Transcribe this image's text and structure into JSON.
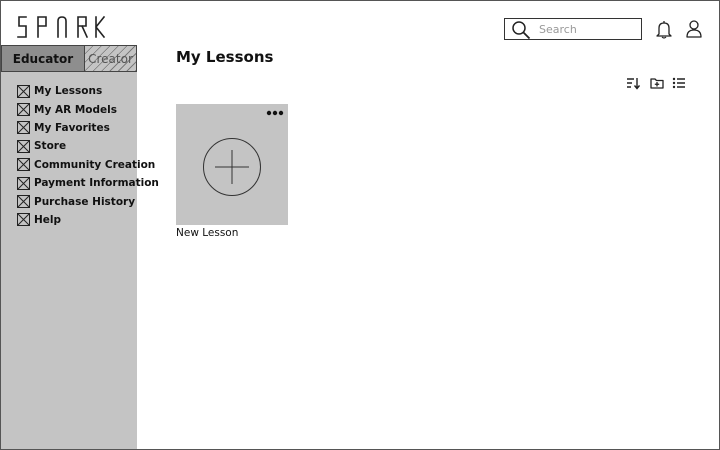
{
  "app": {
    "logo_text": "SPARK"
  },
  "header": {
    "search": {
      "placeholder": "Search",
      "value": ""
    }
  },
  "sidebar": {
    "tabs": [
      {
        "label": "Educator",
        "active": true
      },
      {
        "label": "Creator",
        "active": false
      }
    ],
    "items": [
      {
        "label": "My Lessons",
        "icon": "placeholder-image-icon"
      },
      {
        "label": "My AR Models",
        "icon": "placeholder-image-icon"
      },
      {
        "label": "My Favorites",
        "icon": "placeholder-image-icon"
      },
      {
        "label": "Store",
        "icon": "placeholder-image-icon"
      },
      {
        "label": "Community Creation",
        "icon": "placeholder-image-icon"
      },
      {
        "label": "Payment Information",
        "icon": "placeholder-image-icon"
      },
      {
        "label": "Purchase History",
        "icon": "placeholder-image-icon"
      },
      {
        "label": "Help",
        "icon": "placeholder-image-icon"
      }
    ]
  },
  "main": {
    "title": "My Lessons",
    "toolbar": [
      "sort-icon",
      "new-folder-icon",
      "list-view-icon"
    ],
    "cards": [
      {
        "label": "New Lesson",
        "icon": "plus-circle-icon"
      }
    ]
  },
  "colors": {
    "sidebar_bg": "#c4c4c4",
    "active_tab_bg": "#8e8e8e",
    "card_bg": "#c4c4c4"
  }
}
